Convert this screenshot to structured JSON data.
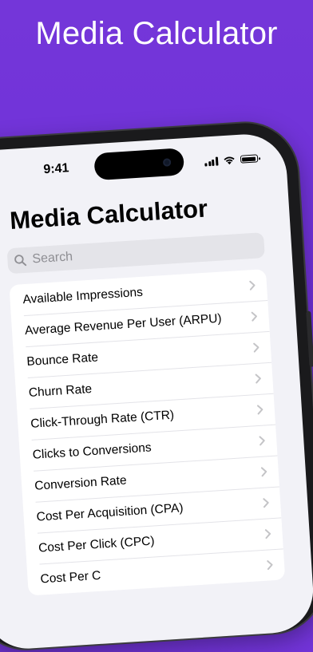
{
  "headline": "Media Calculator",
  "status_bar": {
    "time": "9:41"
  },
  "nav": {
    "title": "Media Calculator"
  },
  "search": {
    "placeholder": "Search"
  },
  "list": [
    {
      "label": "Available Impressions"
    },
    {
      "label": "Average Revenue Per User (ARPU)"
    },
    {
      "label": "Bounce Rate"
    },
    {
      "label": "Churn Rate"
    },
    {
      "label": "Click-Through Rate (CTR)"
    },
    {
      "label": "Clicks to Conversions"
    },
    {
      "label": "Conversion Rate"
    },
    {
      "label": "Cost Per Acquisition (CPA)"
    },
    {
      "label": "Cost Per Click (CPC)"
    },
    {
      "label": "Cost Per C"
    }
  ],
  "colors": {
    "background": "#7436d9",
    "screen": "#f2f2f7",
    "accent_text": "#ffffff"
  }
}
